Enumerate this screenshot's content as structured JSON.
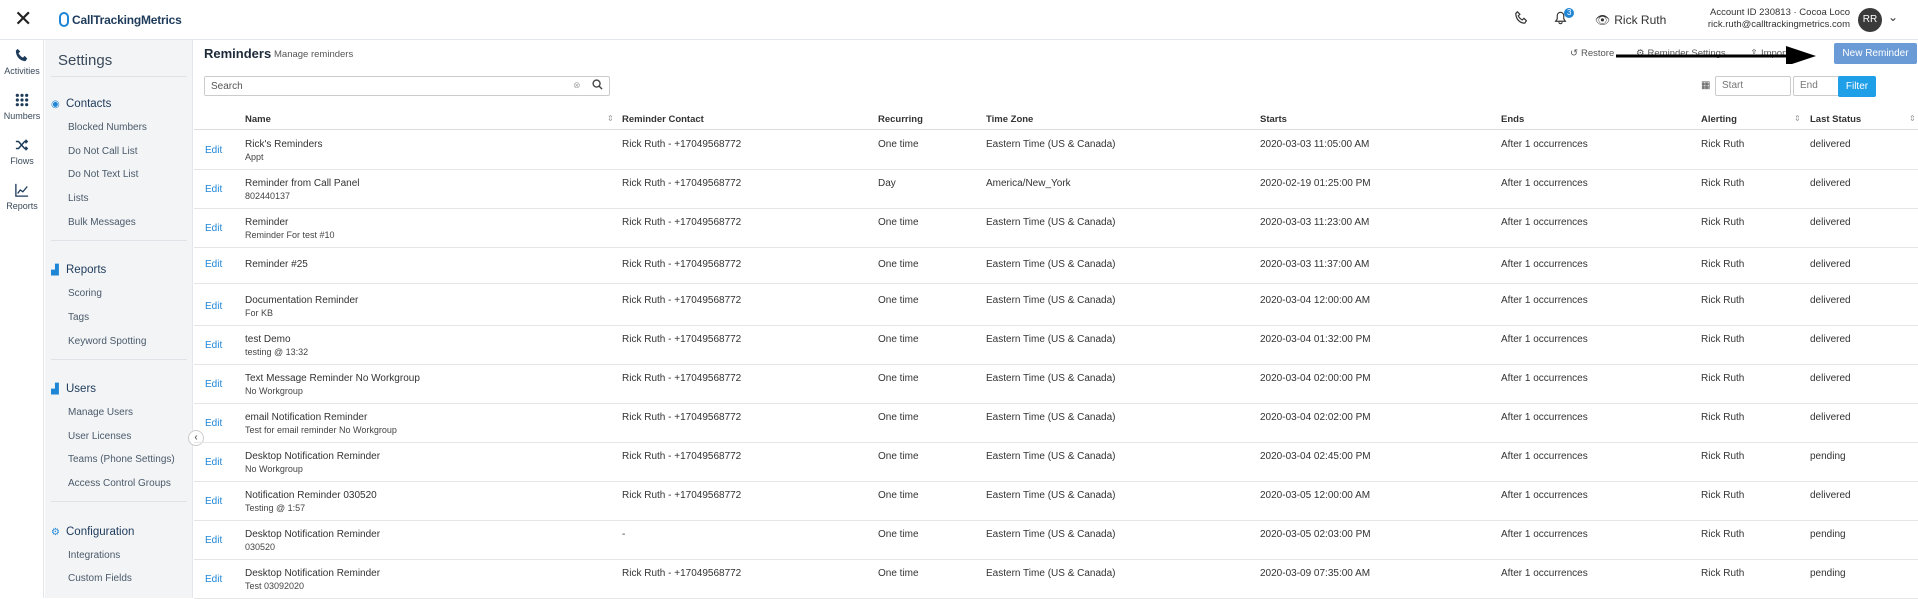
{
  "topbar": {
    "logo_text": "CallTrackingMetrics",
    "notification_count": "3",
    "viewing_user": "Rick Ruth",
    "account_line": "Account ID 230813  ·  Cocoa Loco",
    "email": "rick.ruth@calltrackingmetrics.com",
    "avatar_initials": "RR"
  },
  "rail": {
    "activities": "Activities",
    "numbers": "Numbers",
    "flows": "Flows",
    "reports": "Reports"
  },
  "sidebar": {
    "title": "Settings",
    "contacts": {
      "label": "Contacts",
      "items": [
        "Blocked Numbers",
        "Do Not Call List",
        "Do Not Text List",
        "Lists",
        "Bulk Messages"
      ]
    },
    "reports": {
      "label": "Reports",
      "items": [
        "Scoring",
        "Tags",
        "Keyword Spotting"
      ]
    },
    "users": {
      "label": "Users",
      "items": [
        "Manage Users",
        "User Licenses",
        "Teams (Phone Settings)",
        "Access Control Groups"
      ]
    },
    "configuration": {
      "label": "Configuration",
      "items": [
        "Integrations",
        "Custom Fields"
      ]
    }
  },
  "page": {
    "title": "Reminders",
    "subtitle": "Manage reminders",
    "restore": "Restore",
    "reminder_settings": "Reminder Settings",
    "import": "Import",
    "new_button": "New Reminder",
    "search_placeholder": "Search",
    "start_placeholder": "Start",
    "end_placeholder": "End",
    "filter_button": "Filter"
  },
  "table": {
    "headers": [
      "Name",
      "Reminder Contact",
      "Recurring",
      "Time Zone",
      "Starts",
      "Ends",
      "Alerting",
      "Last Status"
    ],
    "edit_label": "Edit",
    "rows": [
      {
        "name": "Rick's Reminders",
        "sub": "Appt",
        "contact": "Rick Ruth - +17049568772",
        "recurring": "One time",
        "tz": "Eastern Time (US & Canada)",
        "starts": "2020-03-03 11:05:00 AM",
        "ends": "After 1 occurrences",
        "alerting": "Rick Ruth",
        "status": "delivered"
      },
      {
        "name": "Reminder from Call Panel",
        "sub": "802440137",
        "contact": "Rick Ruth - +17049568772",
        "recurring": "Day",
        "tz": "America/New_York",
        "starts": "2020-02-19 01:25:00 PM",
        "ends": "After 1 occurrences",
        "alerting": "Rick Ruth",
        "status": "delivered"
      },
      {
        "name": "Reminder",
        "sub": "Reminder For test #10",
        "contact": "Rick Ruth - +17049568772",
        "recurring": "One time",
        "tz": "Eastern Time (US & Canada)",
        "starts": "2020-03-03 11:23:00 AM",
        "ends": "After 1 occurrences",
        "alerting": "Rick Ruth",
        "status": "delivered"
      },
      {
        "name": "Reminder #25",
        "sub": "",
        "contact": "Rick Ruth - +17049568772",
        "recurring": "One time",
        "tz": "Eastern Time (US & Canada)",
        "starts": "2020-03-03 11:37:00 AM",
        "ends": "After 1 occurrences",
        "alerting": "Rick Ruth",
        "status": "delivered"
      },
      {
        "name": "Documentation Reminder",
        "sub": "For KB",
        "contact": "Rick Ruth - +17049568772",
        "recurring": "One time",
        "tz": "Eastern Time (US & Canada)",
        "starts": "2020-03-04 12:00:00 AM",
        "ends": "After 1 occurrences",
        "alerting": "Rick Ruth",
        "status": "delivered"
      },
      {
        "name": "test Demo",
        "sub": "testing @ 13:32",
        "contact": "Rick Ruth - +17049568772",
        "recurring": "One time",
        "tz": "Eastern Time (US & Canada)",
        "starts": "2020-03-04 01:32:00 PM",
        "ends": "After 1 occurrences",
        "alerting": "Rick Ruth",
        "status": "delivered"
      },
      {
        "name": "Text Message Reminder No Workgroup",
        "sub": "No Workgroup",
        "contact": "Rick Ruth - +17049568772",
        "recurring": "One time",
        "tz": "Eastern Time (US & Canada)",
        "starts": "2020-03-04 02:00:00 PM",
        "ends": "After 1 occurrences",
        "alerting": "Rick Ruth",
        "status": "delivered"
      },
      {
        "name": "email Notification Reminder",
        "sub": "Test for email reminder No Workgroup",
        "contact": "Rick Ruth - +17049568772",
        "recurring": "One time",
        "tz": "Eastern Time (US & Canada)",
        "starts": "2020-03-04 02:02:00 PM",
        "ends": "After 1 occurrences",
        "alerting": "Rick Ruth",
        "status": "delivered"
      },
      {
        "name": "Desktop Notification Reminder",
        "sub": "No Workgroup",
        "contact": "Rick Ruth - +17049568772",
        "recurring": "One time",
        "tz": "Eastern Time (US & Canada)",
        "starts": "2020-03-04 02:45:00 PM",
        "ends": "After 1 occurrences",
        "alerting": "Rick Ruth",
        "status": "pending"
      },
      {
        "name": "Notification Reminder 030520",
        "sub": "Testing @ 1:57",
        "contact": "Rick Ruth - +17049568772",
        "recurring": "One time",
        "tz": "Eastern Time (US & Canada)",
        "starts": "2020-03-05 12:00:00 AM",
        "ends": "After 1 occurrences",
        "alerting": "Rick Ruth",
        "status": "delivered"
      },
      {
        "name": "Desktop Notification Reminder",
        "sub": "030520",
        "contact": "-",
        "recurring": "One time",
        "tz": "Eastern Time (US & Canada)",
        "starts": "2020-03-05 02:03:00 PM",
        "ends": "After 1 occurrences",
        "alerting": "Rick Ruth",
        "status": "pending"
      },
      {
        "name": "Desktop Notification Reminder",
        "sub": "Test 03092020",
        "contact": "Rick Ruth - +17049568772",
        "recurring": "One time",
        "tz": "Eastern Time (US & Canada)",
        "starts": "2020-03-09 07:35:00 AM",
        "ends": "After 1 occurrences",
        "alerting": "Rick Ruth",
        "status": "pending"
      }
    ]
  },
  "colors": {
    "accent": "#1f86d6",
    "new_button": "#6a9bd6",
    "filter_button": "#1f9fe8"
  }
}
